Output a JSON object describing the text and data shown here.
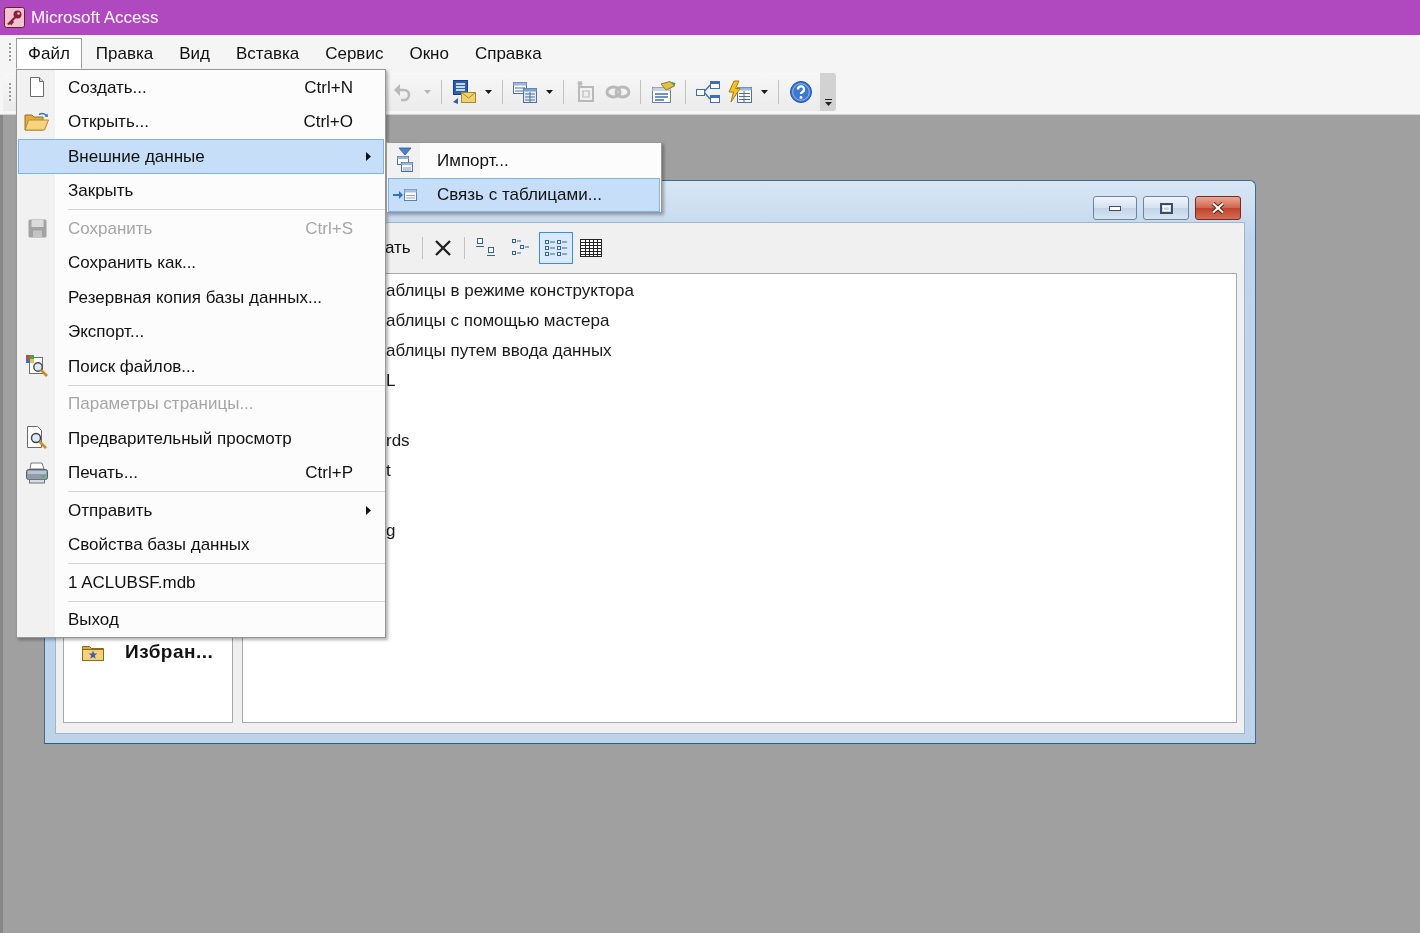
{
  "window": {
    "title": "Microsoft Access"
  },
  "menu_bar": {
    "items": [
      {
        "label": "Файл",
        "selected": true
      },
      {
        "label": "Правка",
        "selected": false
      },
      {
        "label": "Вид",
        "selected": false
      },
      {
        "label": "Вставка",
        "selected": false
      },
      {
        "label": "Сервис",
        "selected": false
      },
      {
        "label": "Окно",
        "selected": false
      },
      {
        "label": "Справка",
        "selected": false
      }
    ]
  },
  "file_menu": {
    "sections": [
      [
        {
          "label": "Создать...",
          "shortcut": "Ctrl+N",
          "disabled": false,
          "selected": false,
          "submenu": false
        },
        {
          "label": "Открыть...",
          "shortcut": "Ctrl+O",
          "disabled": false,
          "selected": false,
          "submenu": false
        },
        {
          "label": "Внешние данные",
          "disabled": false,
          "selected": true,
          "submenu": true
        },
        {
          "label": "Закрыть",
          "disabled": false,
          "selected": false,
          "submenu": false
        }
      ],
      [
        {
          "label": "Сохранить",
          "shortcut": "Ctrl+S",
          "disabled": true,
          "selected": false,
          "submenu": false
        },
        {
          "label": "Сохранить как...",
          "disabled": false,
          "selected": false,
          "submenu": false
        },
        {
          "label": "Резервная копия базы данных...",
          "disabled": false,
          "selected": false,
          "submenu": false
        },
        {
          "label": "Экспорт...",
          "disabled": false,
          "selected": false,
          "submenu": false
        },
        {
          "label": "Поиск файлов...",
          "disabled": false,
          "selected": false,
          "submenu": false
        }
      ],
      [
        {
          "label": "Параметры страницы...",
          "disabled": true,
          "selected": false,
          "submenu": false
        },
        {
          "label": "Предварительный просмотр",
          "disabled": false,
          "selected": false,
          "submenu": false
        },
        {
          "label": "Печать...",
          "shortcut": "Ctrl+P",
          "disabled": false,
          "selected": false,
          "submenu": false
        }
      ],
      [
        {
          "label": "Отправить",
          "disabled": false,
          "selected": false,
          "submenu": true
        },
        {
          "label": "Свойства базы данных",
          "disabled": false,
          "selected": false,
          "submenu": false
        }
      ],
      [
        {
          "label": "1 ACLUBSF.mdb",
          "disabled": false,
          "selected": false,
          "submenu": false
        }
      ],
      [
        {
          "label": "Выход",
          "disabled": false,
          "selected": false,
          "submenu": false
        }
      ]
    ]
  },
  "external_data_submenu": {
    "items": [
      {
        "label": "Импорт...",
        "selected": false
      },
      {
        "label": "Связь с таблицами...",
        "selected": true
      }
    ]
  },
  "toolbar": {
    "groups": [
      [
        {
          "disabled": true,
          "dropdown": true
        }
      ],
      [
        {
          "disabled": false,
          "dropdown": true
        }
      ],
      [
        {
          "disabled": false,
          "dropdown": true
        }
      ],
      [
        {
          "disabled": true,
          "dropdown": false
        },
        {
          "disabled": true,
          "dropdown": false
        }
      ],
      [
        {
          "disabled": false,
          "dropdown": false
        }
      ],
      [
        {
          "disabled": false,
          "dropdown": false
        },
        {
          "disabled": false,
          "dropdown": true
        }
      ],
      [
        {
          "disabled": false,
          "dropdown": false
        }
      ]
    ]
  },
  "database_window": {
    "toolbar": {
      "new_button": {
        "label": "ать"
      },
      "view_buttons": [
        {
          "selected": false
        },
        {
          "selected": false
        },
        {
          "selected": true
        },
        {
          "selected": false
        }
      ]
    },
    "objects_bar": {
      "items": [
        {
          "label": "Избран..."
        }
      ]
    },
    "object_list": {
      "rows": [
        {
          "kind": "text",
          "text": "аблицы в режиме конструктора"
        },
        {
          "kind": "text",
          "text": "аблицы с помощью мастера"
        },
        {
          "kind": "text",
          "text": "аблицы путем ввода данных"
        },
        {
          "kind": "text",
          "text": "L"
        },
        {
          "kind": "covered"
        },
        {
          "kind": "text",
          "text": "rds"
        },
        {
          "kind": "text",
          "text": "t"
        },
        {
          "kind": "covered"
        },
        {
          "kind": "text",
          "text": "g"
        }
      ]
    }
  }
}
